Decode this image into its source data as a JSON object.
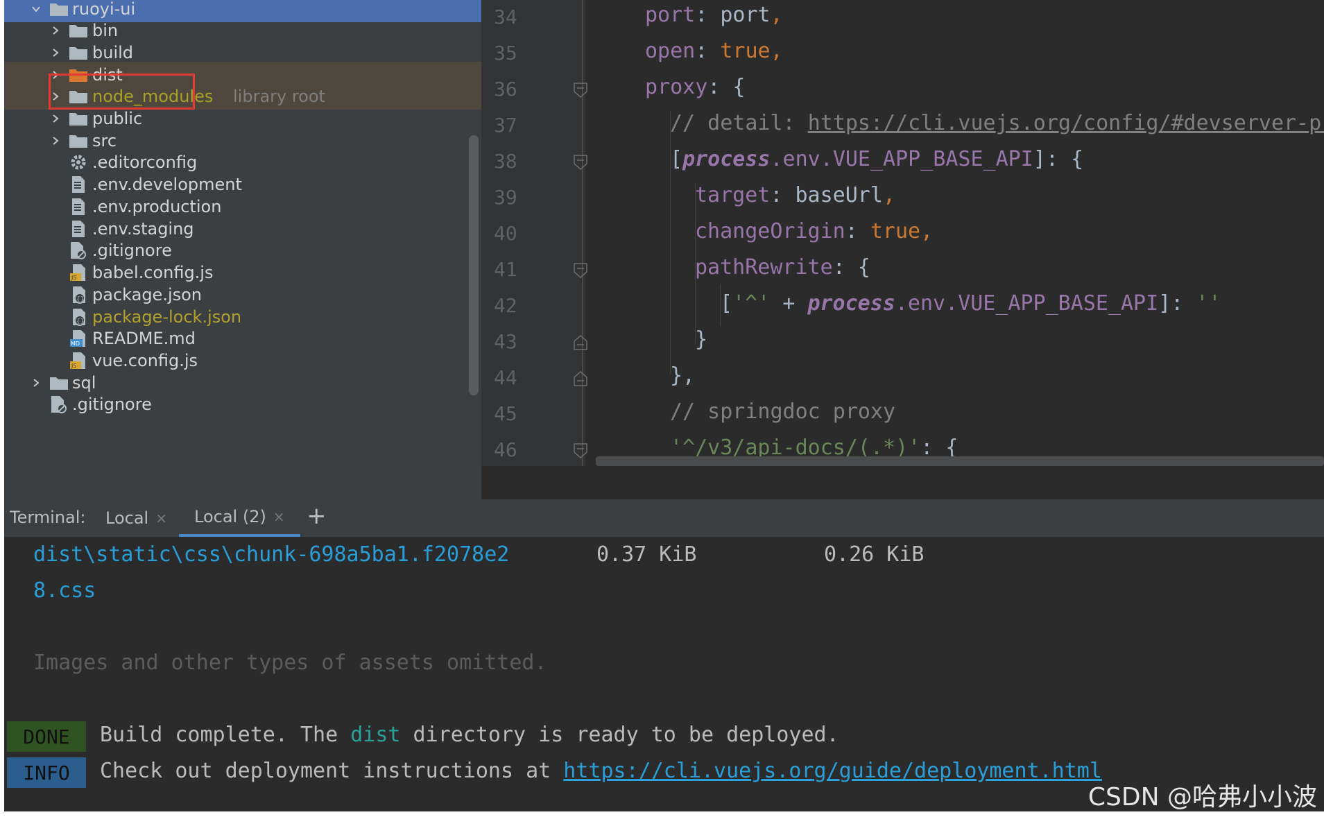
{
  "tree": {
    "items": [
      {
        "label": "ruoyi-ui",
        "type": "folder",
        "expanded": true
      },
      {
        "label": "bin",
        "type": "folder"
      },
      {
        "label": "build",
        "type": "folder"
      },
      {
        "label": "dist",
        "type": "folder"
      },
      {
        "label": "node_modules",
        "suffix": "library root",
        "type": "folder"
      },
      {
        "label": "public",
        "type": "folder"
      },
      {
        "label": "src",
        "type": "folder"
      },
      {
        "label": ".editorconfig",
        "type": "config"
      },
      {
        "label": ".env.development",
        "type": "file"
      },
      {
        "label": ".env.production",
        "type": "file"
      },
      {
        "label": ".env.staging",
        "type": "file"
      },
      {
        "label": ".gitignore",
        "type": "gitignore"
      },
      {
        "label": "babel.config.js",
        "type": "js"
      },
      {
        "label": "package.json",
        "type": "json"
      },
      {
        "label": "package-lock.json",
        "type": "json"
      },
      {
        "label": "README.md",
        "type": "md"
      },
      {
        "label": "vue.config.js",
        "type": "js"
      },
      {
        "label": "sql",
        "type": "folder"
      },
      {
        "label": ".gitignore",
        "type": "gitignore"
      }
    ]
  },
  "editor": {
    "line_numbers": [
      "34",
      "35",
      "36",
      "37",
      "38",
      "39",
      "40",
      "41",
      "42",
      "43",
      "44",
      "45",
      "46"
    ],
    "lines": {
      "l34": {
        "key": "port",
        "colon": ": ",
        "val": "port",
        "comma": ","
      },
      "l35": {
        "key": "open",
        "colon": ": ",
        "val": "true",
        "comma": ","
      },
      "l36": {
        "key": "proxy",
        "rest": ": {"
      },
      "l37": {
        "comment": "// detail: ",
        "url": "https://cli.vuejs.org/config/#devserver-proxy"
      },
      "l38": {
        "open": "[",
        "proc": "process",
        "rest": ".env.",
        "var": "VUE_APP_BASE_API",
        "close": "]: {"
      },
      "l39": {
        "key": "target",
        "colon": ": ",
        "val": "baseUrl",
        "comma": ","
      },
      "l40": {
        "key": "changeOrigin",
        "colon": ": ",
        "val": "true",
        "comma": ","
      },
      "l41": {
        "key": "pathRewrite",
        "rest": ": {"
      },
      "l42": {
        "open": "[",
        "str": "'^'",
        "plus": " + ",
        "proc": "process",
        "rest": ".env.",
        "var": "VUE_APP_BASE_API",
        "close": "]: ",
        "str2": "''"
      },
      "l43": {
        "text": "}"
      },
      "l44": {
        "text": "},"
      },
      "l45": {
        "comment": "// springdoc proxy"
      },
      "l46": {
        "str": "'^/v3/api-docs/(.*)'",
        "rest": ": {"
      }
    }
  },
  "terminal": {
    "title": "Terminal:",
    "tabs": [
      "Local",
      "Local (2)"
    ],
    "add": "+",
    "close": "×",
    "output": {
      "file_a": "dist\\static\\css\\chunk-698a5ba1.f2078e2",
      "file_b": "8.css",
      "size": "0.37 KiB",
      "gzip": "0.26 KiB",
      "omitted": "Images and other types of assets omitted.",
      "done_badge": "DONE",
      "done_pre": "Build complete. The ",
      "done_dist": "dist",
      "done_post": " directory is ready to be deployed.",
      "info_badge": "INFO",
      "info_pre": "Check out deployment instructions at ",
      "info_link": "https://cli.vuejs.org/guide/deployment.html"
    }
  },
  "watermark": "CSDN @哈弗小小波",
  "colors": {
    "selected_row": "#4b6eaf",
    "highlight_row": "#4d473d",
    "red_box": "#e53935",
    "terminal_link": "#299ed8"
  }
}
